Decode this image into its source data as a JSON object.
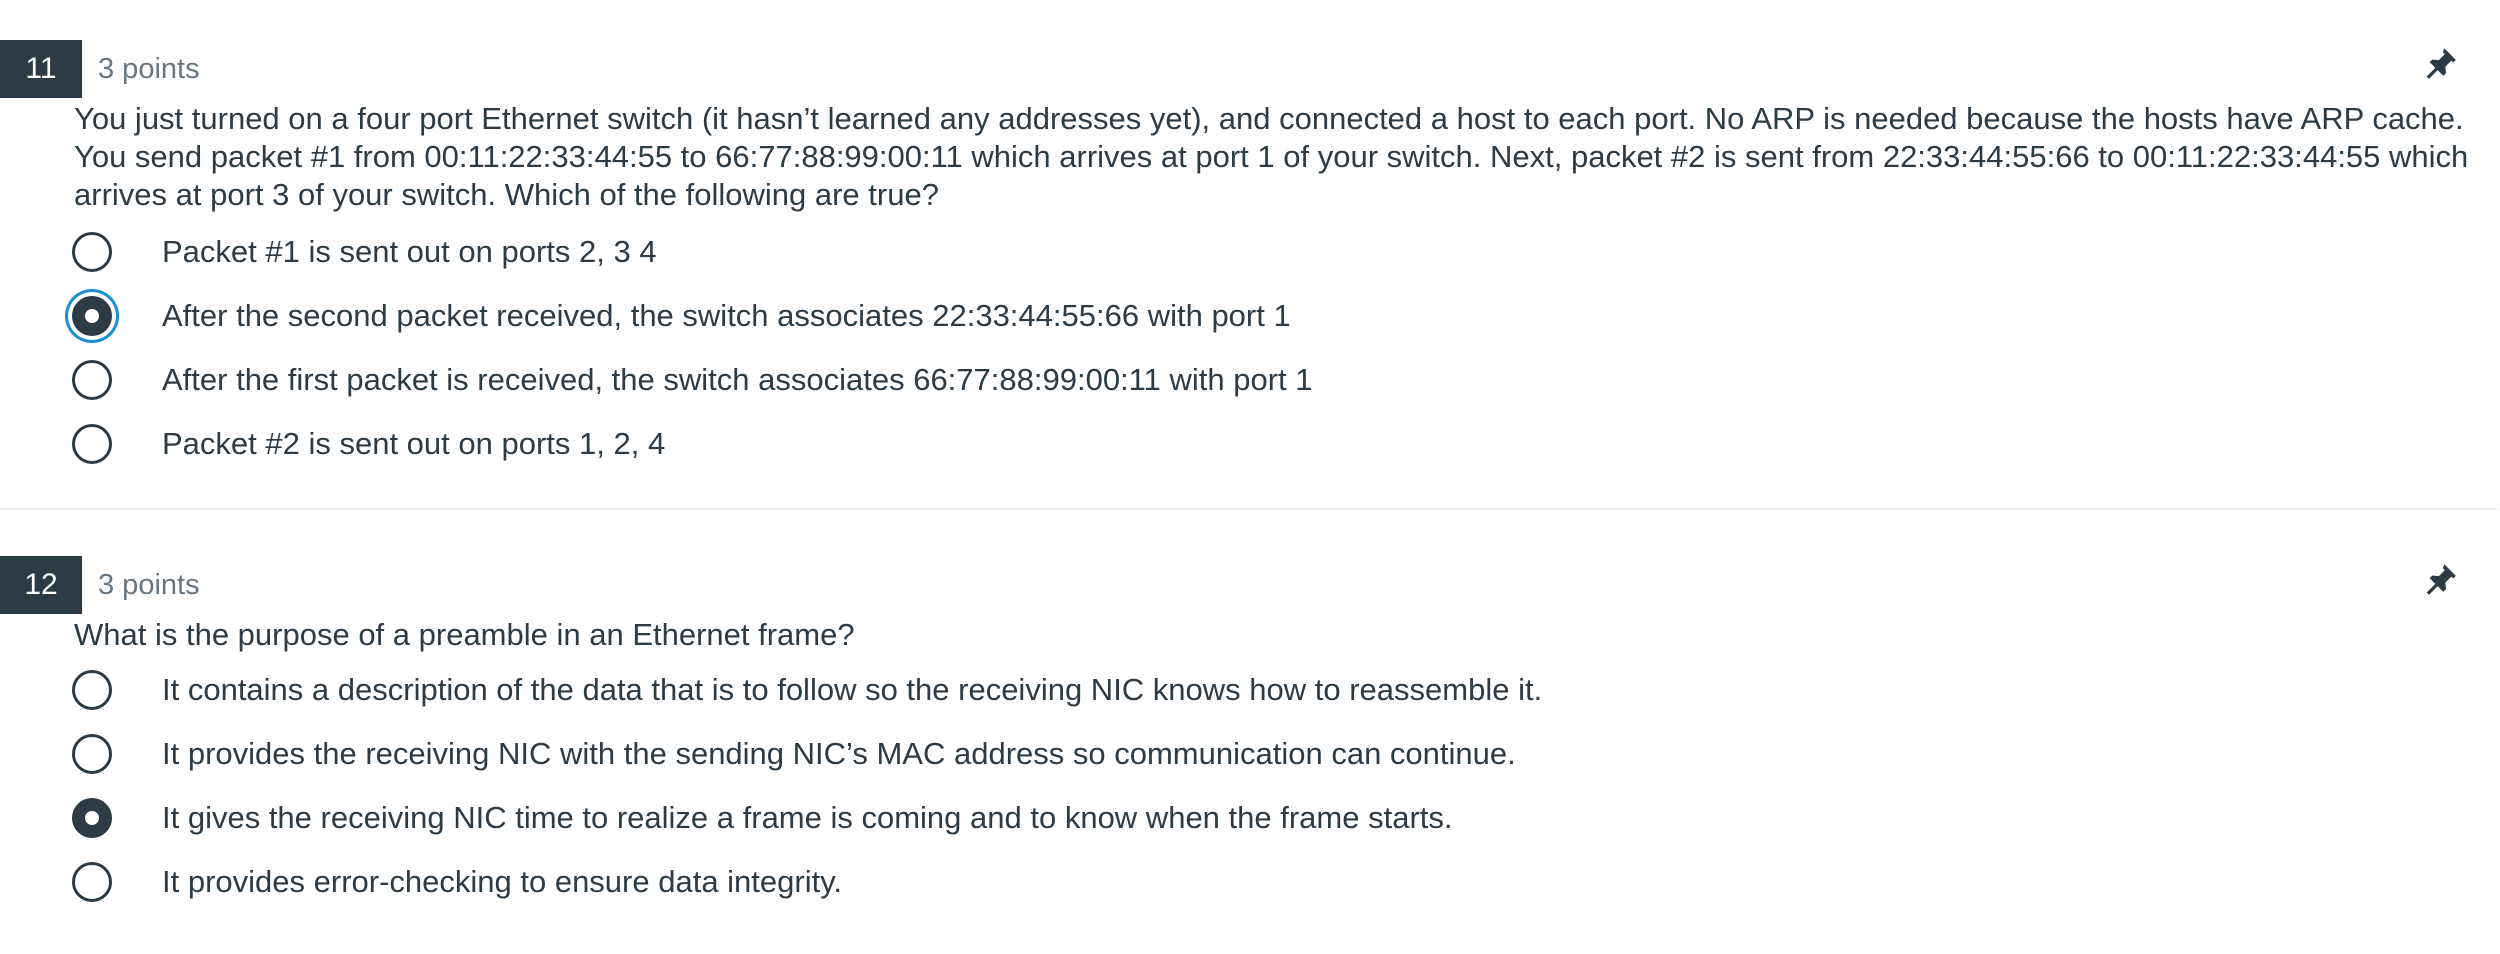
{
  "questions": [
    {
      "number": "11",
      "points": "3 points",
      "pin_icon": "pin-icon",
      "text": "You just turned on a four port Ethernet switch (it hasn’t learned any addresses yet), and connected a host to each port. No ARP is needed because the hosts have ARP cache. You send packet #1 from 00:11:22:33:44:55 to 66:77:88:99:00:11 which arrives at port 1 of your switch. Next, packet #2 is sent from 22:33:44:55:66 to 00:11:22:33:44:55 which arrives at port 3 of your switch. Which of the following are true?",
      "selected_index": 1,
      "options": [
        "Packet #1 is sent out on ports 2, 3 4",
        "After the second packet received, the switch associates 22:33:44:55:66 with port 1",
        "After the first packet is received, the switch associates 66:77:88:99:00:11 with port 1",
        "Packet #2 is sent out on ports 1, 2, 4"
      ]
    },
    {
      "number": "12",
      "points": "3 points",
      "pin_icon": "pin-icon",
      "text": "What is the purpose of a preamble in an Ethernet frame?",
      "selected_index": 2,
      "options": [
        "It contains a description of the data that is to follow so the receiving NIC knows how to reassemble it.",
        "It provides the receiving NIC with the sending NIC’s MAC address so communication can continue.",
        "It gives the receiving NIC time to realize a frame is coming and to know when the frame starts.",
        "It provides error-checking to ensure data integrity."
      ]
    }
  ],
  "colors": {
    "accent_focus": "#1a8fd8",
    "dark": "#2d3b45",
    "muted": "#6b7780"
  }
}
